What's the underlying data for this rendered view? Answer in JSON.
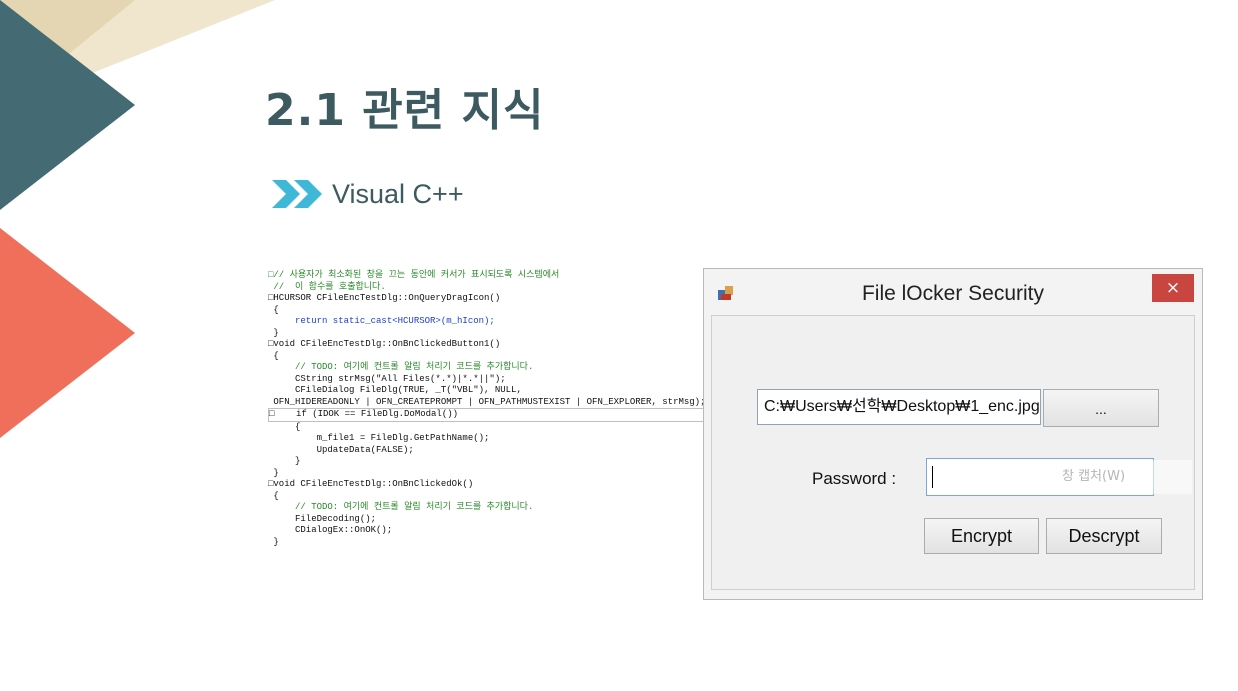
{
  "slide": {
    "title": "2.1 관련 지식",
    "subtitle": "Visual C++",
    "colors": {
      "teal": "#446a73",
      "coral": "#ef6f5b",
      "beige": "#e4d6b3",
      "cream": "#efe6cd",
      "title_text": "#3d5a60",
      "chevron": "#3fb8d8"
    }
  },
  "code": {
    "lines": [
      "□// 사용자가 최소화된 창을 끄는 동안에 커서가 표시되도록 시스템에서",
      " //  이 함수를 호출합니다.",
      "□HCURSOR CFileEncTestDlg::OnQueryDragIcon()",
      " {",
      "     return static_cast<HCURSOR>(m_hIcon);",
      " }",
      "",
      "",
      "",
      "□void CFileEncTestDlg::OnBnClickedButton1()",
      " {",
      "     // TODO: 여기에 컨트롤 알림 처리기 코드를 추가합니다.",
      "     CString strMsg(\"All Files(*.*)|*.*||\");",
      "     CFileDialog FileDlg(TRUE, _T(\"VBL\"), NULL,",
      " OFN_HIDEREADONLY | OFN_CREATEPROMPT | OFN_PATHMUSTEXIST | OFN_EXPLORER, strMsg);",
      "",
      "□    if (IDOK == FileDlg.DoModal())",
      "     {",
      "         m_file1 = FileDlg.GetPathName();",
      "",
      "         UpdateData(FALSE);",
      "     }",
      " }",
      "",
      "",
      "□void CFileEncTestDlg::OnBnClickedOk()",
      " {",
      "     // TODO: 여기에 컨트롤 알림 처리기 코드를 추가합니다.",
      "     FileDecoding();",
      "     CDialogEx::OnOK();",
      " }"
    ]
  },
  "dialog": {
    "title": "File lOcker Security",
    "close_glyph": "×",
    "app_icon": "app-icon",
    "path_value": "C:₩Users₩선학₩Desktop₩1_enc.jpg",
    "browse_label": "...",
    "password_label": "Password :",
    "password_value": "",
    "ghost_overlay": "창 캡처(W)",
    "encrypt_label": "Encrypt",
    "decrypt_label": "Descrypt"
  }
}
